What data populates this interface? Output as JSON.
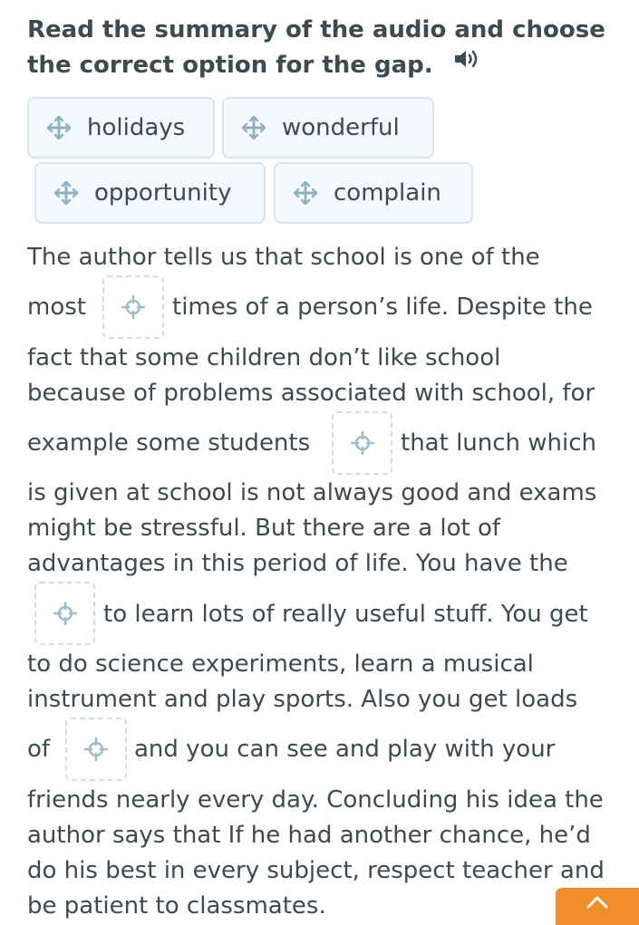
{
  "instruction": {
    "line1": "Read the summary of the audio and choose",
    "line2": "the correct option for the gap."
  },
  "icons": {
    "audio": "speaker-icon",
    "drag": "move-arrows-icon",
    "drop": "target-icon",
    "scroll_top": "chevron-up-icon"
  },
  "options": [
    "holidays",
    "wonderful",
    "opportunity",
    "complain"
  ],
  "text_lines": [
    "The author tells us that school is one of the",
    "most",
    "times of a person’s life. Despite the",
    "fact that some children don’t like school",
    "because of problems associated with school, for",
    "example some students",
    "that lunch which",
    "is given at school is not always good and exams",
    "might be stressful. But there are a lot of",
    "advantages in this period of life. You have the",
    "to learn lots of really useful stuff. You get",
    "to do science experiments, learn a musical",
    "instrument and play sports. Also you get loads",
    "of",
    "and you can see and play with your",
    "friends nearly every day. Concluding his idea the",
    "author says that If he had another chance, he’d",
    "do his best in every subject, respect teacher and",
    "be patient to classmates."
  ],
  "colors": {
    "accent": "#ef8e2a",
    "chip_bg": "#f3f9fc",
    "chip_border": "#d5e6ef",
    "icon": "#8fb1c2",
    "text": "#3d4a52"
  }
}
